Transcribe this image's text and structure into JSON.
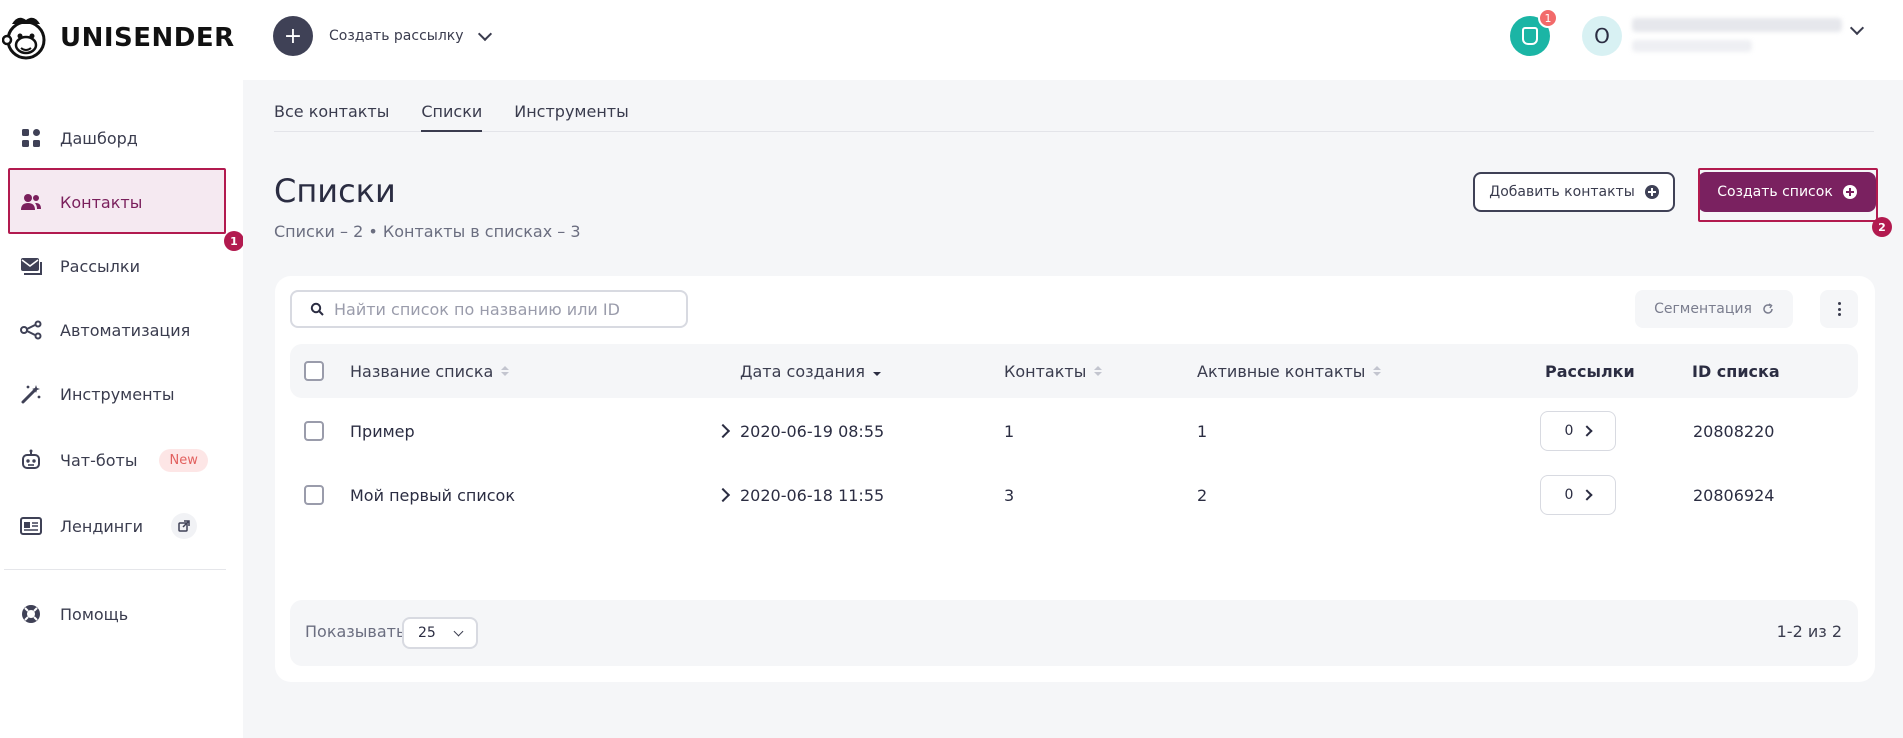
{
  "header": {
    "brand": "UNISENDER",
    "create_campaign_label": "Создать рассылку",
    "notifications_count": "1",
    "avatar_initial": "O"
  },
  "sidebar": {
    "items": [
      {
        "label": "Дашборд",
        "icon": "dashboard-grid-icon"
      },
      {
        "label": "Контакты",
        "icon": "contacts-people-icon",
        "active": true
      },
      {
        "label": "Рассылки",
        "icon": "mail-stack-icon"
      },
      {
        "label": "Автоматизация",
        "icon": "automation-nodes-icon"
      },
      {
        "label": "Инструменты",
        "icon": "magic-wand-icon"
      },
      {
        "label": "Чат-боты",
        "icon": "robot-icon",
        "badge": "New"
      },
      {
        "label": "Лендинги",
        "icon": "landing-page-icon",
        "external": true
      },
      {
        "label": "Помощь",
        "icon": "help-lifebuoy-icon"
      }
    ]
  },
  "annotations": {
    "marker_1": "1",
    "marker_2": "2",
    "color": "#b21a4f"
  },
  "tabs": [
    {
      "label": "Все контакты"
    },
    {
      "label": "Списки",
      "active": true
    },
    {
      "label": "Инструменты"
    }
  ],
  "page": {
    "title": "Списки",
    "subtitle": "Списки – 2 • Контакты в списках – 3",
    "add_contacts_label": "Добавить контакты",
    "create_list_label": "Создать список"
  },
  "toolbar": {
    "search_placeholder": "Найти список по названию или ID",
    "segmentation_label": "Сегментация"
  },
  "table": {
    "columns": {
      "name": "Название списка",
      "created": "Дата создания",
      "contacts": "Контакты",
      "active_contacts": "Активные контакты",
      "campaigns": "Рассылки",
      "list_id": "ID списка"
    },
    "rows": [
      {
        "name": "Пример",
        "created": "2020-06-19 08:55",
        "contacts": "1",
        "active_contacts": "1",
        "campaigns": "0",
        "list_id": "20808220"
      },
      {
        "name": "Мой первый список",
        "created": "2020-06-18 11:55",
        "contacts": "3",
        "active_contacts": "2",
        "campaigns": "0",
        "list_id": "20806924"
      }
    ]
  },
  "footer": {
    "show_label": "Показывать:",
    "per_page": "25",
    "range_info": "1-2 из 2"
  },
  "colors": {
    "accent": "#7a2160",
    "sidebar_active_bg": "#f5e9f1",
    "notification": "#1bb5a5",
    "badge_red": "#f26a6a"
  }
}
